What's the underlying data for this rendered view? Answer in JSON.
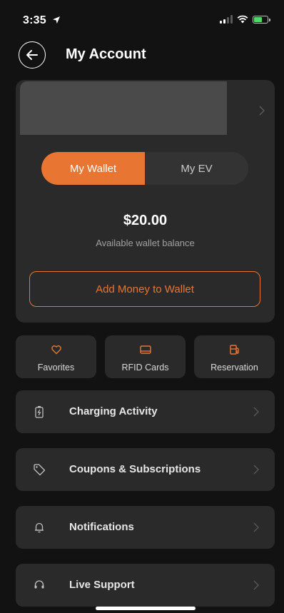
{
  "status_bar": {
    "time": "3:35"
  },
  "header": {
    "title": "My Account"
  },
  "account_card": {
    "tabs": [
      {
        "label": "My Wallet",
        "active": true
      },
      {
        "label": "My EV",
        "active": false
      }
    ],
    "balance": "$20.00",
    "balance_caption": "Available wallet balance",
    "add_money_label": "Add Money to Wallet"
  },
  "quick_actions": [
    {
      "label": "Favorites",
      "icon": "heart-icon"
    },
    {
      "label": "RFID Cards",
      "icon": "card-icon"
    },
    {
      "label": "Reservation",
      "icon": "fuel-pump-icon"
    }
  ],
  "menu": [
    {
      "label": "Charging Activity",
      "icon": "battery-charging-icon"
    },
    {
      "label": "Coupons & Subscriptions",
      "icon": "tag-icon"
    },
    {
      "label": "Notifications",
      "icon": "bell-icon"
    },
    {
      "label": "Live Support",
      "icon": "headset-icon"
    }
  ],
  "colors": {
    "accent": "#e87632",
    "background": "#121212",
    "card": "#2a2a2a"
  }
}
